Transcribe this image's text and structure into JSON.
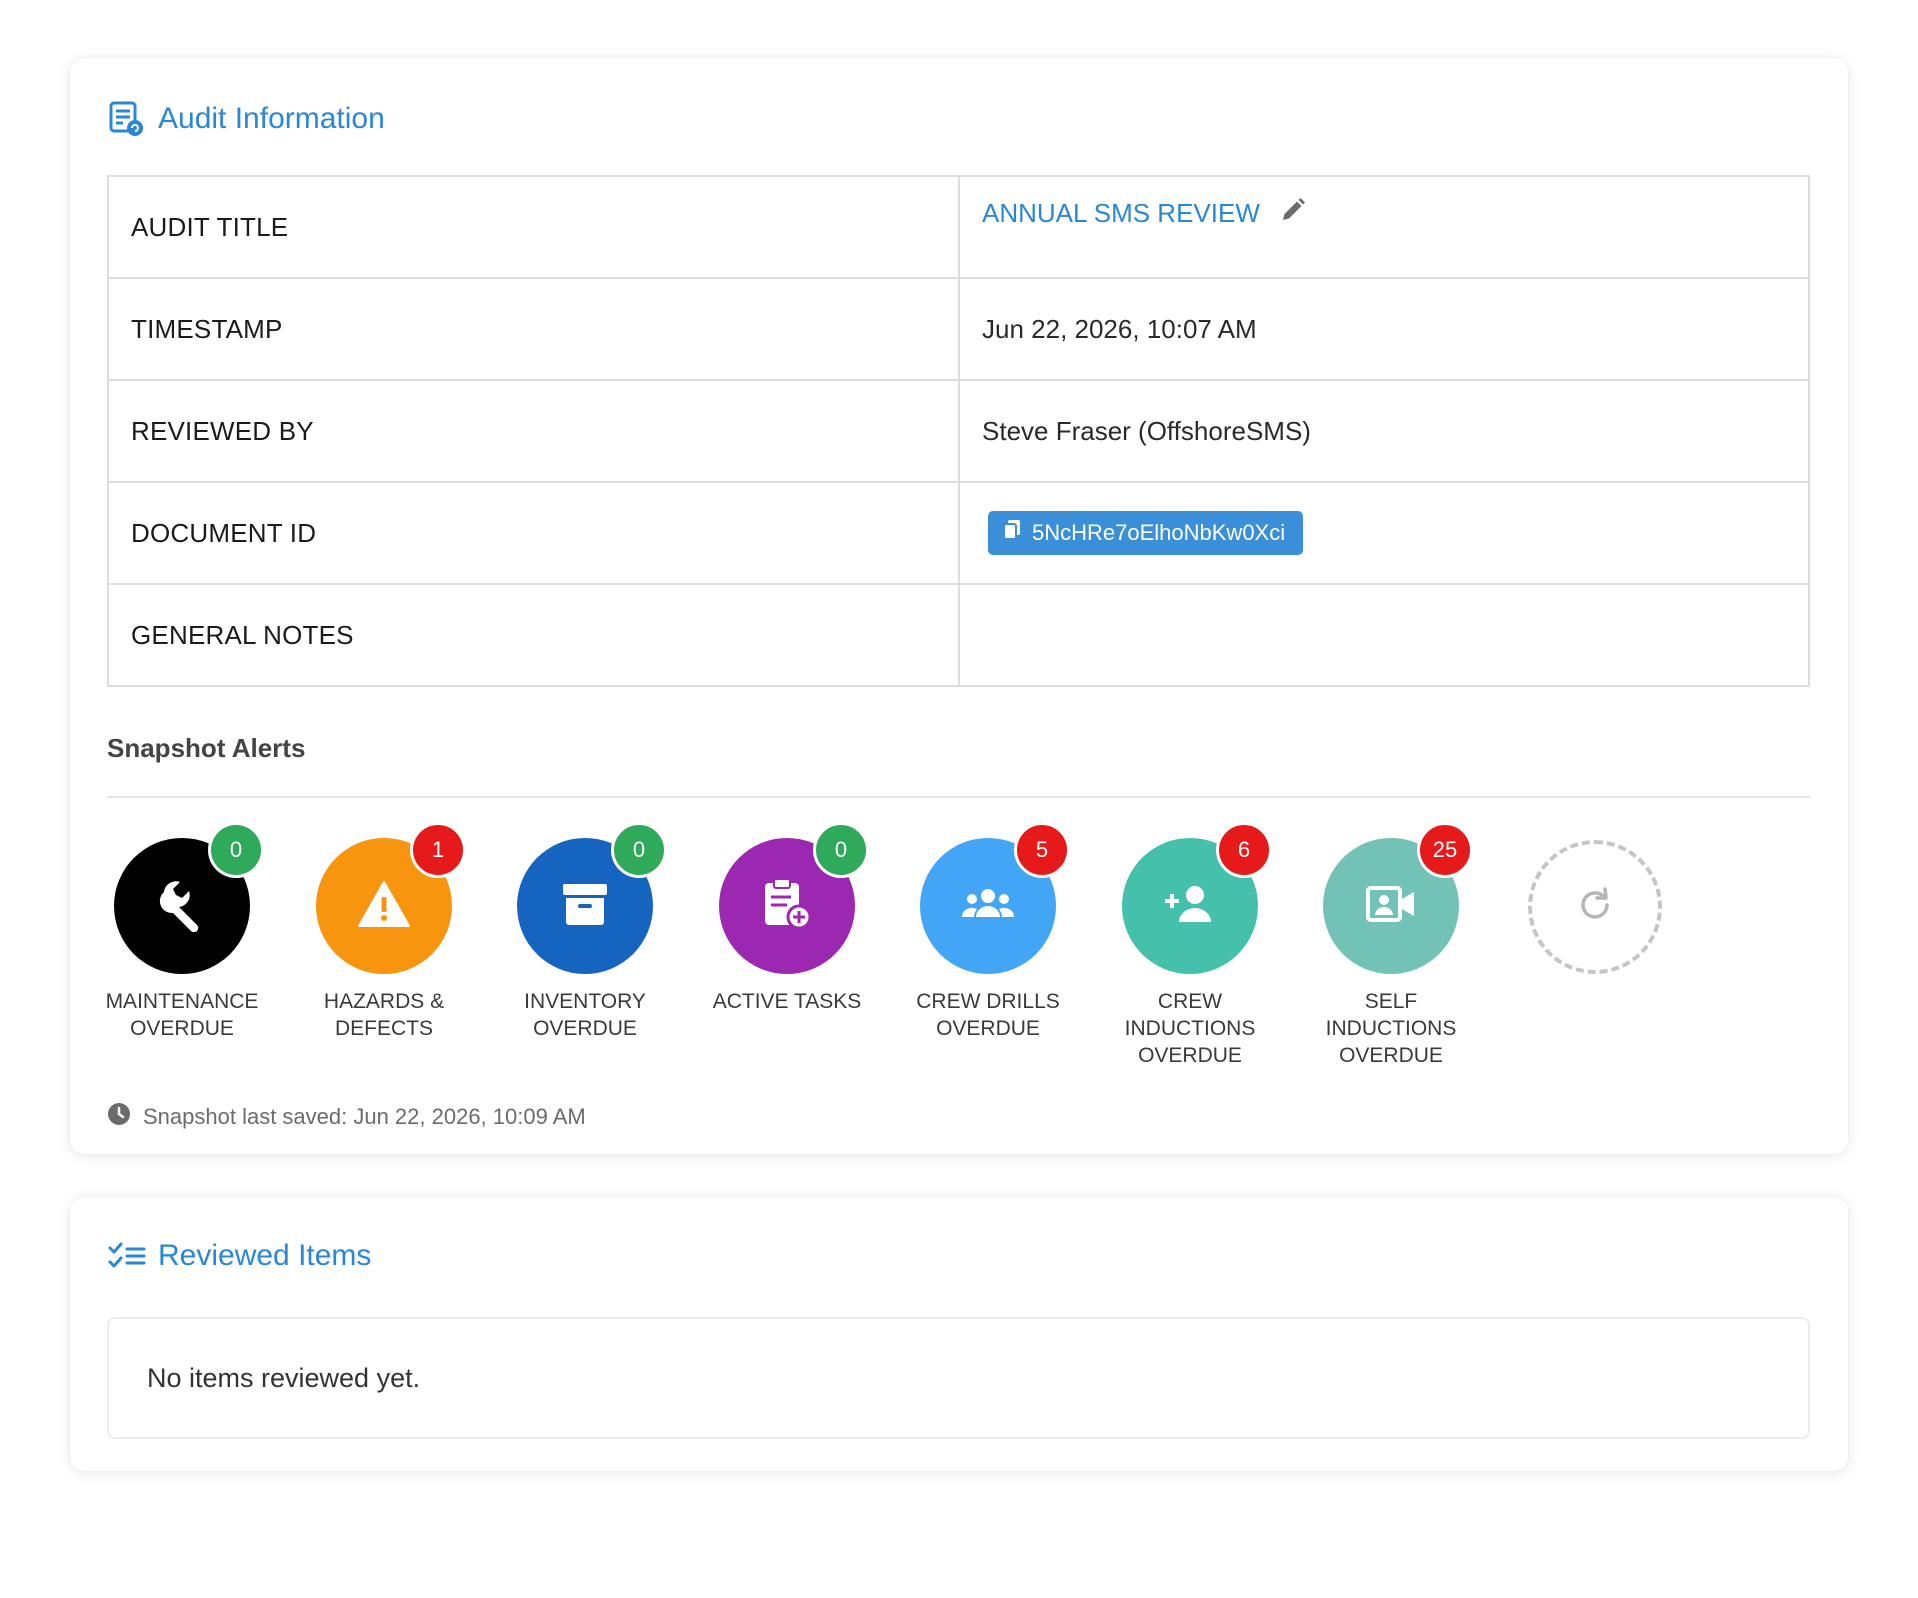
{
  "audit_card": {
    "title": "Audit Information",
    "rows": [
      {
        "label": "AUDIT TITLE",
        "value": "ANNUAL SMS REVIEW"
      },
      {
        "label": "TIMESTAMP",
        "value": "Jun 22, 2026, 10:07 AM"
      },
      {
        "label": "REVIEWED BY",
        "value": "Steve Fraser (OffshoreSMS)"
      },
      {
        "label": "DOCUMENT ID",
        "value": "5NcHRe7oElhoNbKw0Xci"
      },
      {
        "label": "GENERAL NOTES",
        "value": ""
      }
    ]
  },
  "snapshot": {
    "title": "Snapshot Alerts",
    "saved_text": "Snapshot last saved: Jun 22, 2026, 10:09 AM",
    "alerts": [
      {
        "label": "MAINTENANCE\nOVERDUE",
        "count": "0",
        "icon": "wrench-icon",
        "color": "#000000",
        "badge_color": "#2eaa5a"
      },
      {
        "label": "HAZARDS &\nDEFECTS",
        "count": "1",
        "icon": "warning-icon",
        "color": "#f7960e",
        "badge_color": "#e61a1a"
      },
      {
        "label": "INVENTORY\nOVERDUE",
        "count": "0",
        "icon": "archive-icon",
        "color": "#1565c0",
        "badge_color": "#2eaa5a"
      },
      {
        "label": "ACTIVE TASKS",
        "count": "0",
        "icon": "clipboard-add-icon",
        "color": "#9c27b0",
        "badge_color": "#2eaa5a"
      },
      {
        "label": "CREW DRILLS\nOVERDUE",
        "count": "5",
        "icon": "group-icon",
        "color": "#42a5f5",
        "badge_color": "#e61a1a"
      },
      {
        "label": "CREW\nINDUCTIONS\nOVERDUE",
        "count": "6",
        "icon": "user-plus-icon",
        "color": "#45c1ab",
        "badge_color": "#e61a1a"
      },
      {
        "label": "SELF\nINDUCTIONS\nOVERDUE",
        "count": "25",
        "icon": "video-user-icon",
        "color": "#72c2b5",
        "badge_color": "#e61a1a"
      }
    ]
  },
  "reviewed_card": {
    "title": "Reviewed Items",
    "empty_text": "No items reviewed yet."
  }
}
